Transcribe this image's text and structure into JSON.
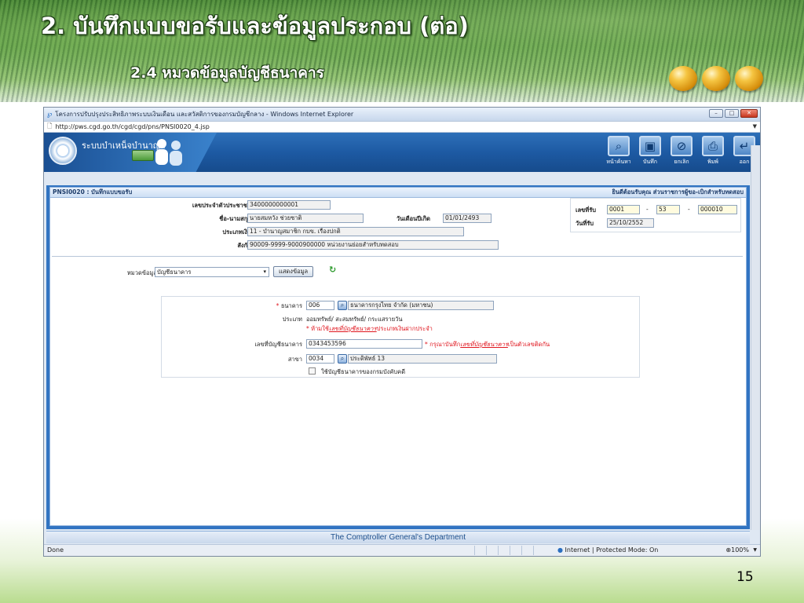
{
  "slide": {
    "title": "2. บันทึกแบบขอรับและข้อมูลประกอบ (ต่อ)",
    "subtitle": "2.4 หมวดข้อมูลบัญชีธนาคาร",
    "page_number": "15"
  },
  "browser": {
    "window_title": "โครงการปรับปรุงประสิทธิภาพระบบเงินเดือน และสวัสดิการของกรมบัญชีกลาง - Windows Internet Explorer",
    "address": "http://pws.cgd.go.th/cgd/cgd/pns/PNSI0020_4.jsp",
    "status_left": "Done",
    "status_zone": "Internet | Protected Mode: On",
    "status_zoom": "100%"
  },
  "app": {
    "name": "ระบบบำเหน็จบำนาญฯ",
    "toolbar": [
      {
        "label": "หน้าค้นหา",
        "icon": "search-icon"
      },
      {
        "label": "บันทึก",
        "icon": "save-icon"
      },
      {
        "label": "ยกเลิก",
        "icon": "cancel-icon"
      },
      {
        "label": "พิมพ์",
        "icon": "print-icon"
      },
      {
        "label": "ออก",
        "icon": "exit-icon"
      }
    ],
    "footer": "The Comptroller General's Department"
  },
  "form": {
    "code_title": "PNSI0020 : บันทึกแบบขอรับ",
    "welcome": "ยินดีต้อนรับคุณ ส่วนราชการผู้ขอ-เบิกสำหรับทดสอบ",
    "citizen_id_label": "เลขประจำตัวประชาชน",
    "citizen_id": "3400000000001",
    "name_label": "ชื่อ-นามสกุล",
    "name": "นายสมหวัง ช่วยชาติ",
    "birthdate_label": "วันเดือนปีเกิด",
    "birthdate": "01/01/2493",
    "money_type_label": "ประเภทเงิน",
    "money_type": "11 - บำนาญสมาชิก กบข.  เรื่องปกติ",
    "affiliation_label": "สังกัด",
    "affiliation": "90009-9999-9000900000  หน่วยงานย่อยสำหรับทดสอบ",
    "receipt_no_label": "เลขที่รับ",
    "receipt_no_1": "0001",
    "receipt_no_sep1": "-",
    "receipt_no_2": "53",
    "receipt_no_sep2": "-",
    "receipt_no_3": "000010",
    "receipt_date_label": "วันที่รับ",
    "receipt_date": "25/10/2552",
    "category_label": "หมวดข้อมูล",
    "category_value": "บัญชีธนาคาร",
    "show_data_button": "แสดงข้อมูล",
    "bank_label": "ธนาคาร",
    "required_mark": "*",
    "bank_code": "006",
    "bank_name": "ธนาคารกรุงไทย จำกัด (มหาชน)",
    "account_type_label": "ประเภท",
    "account_type_value": "ออมทรัพย์/ สะสมทรัพย์/ กระแสรายวัน",
    "account_type_warning_pre": "* ห้ามใช้",
    "account_type_warning_link": "เลขที่บัญชีธนาคาร",
    "account_type_warning_post": "ประเภทเงินฝากประจำ",
    "account_no_label": "เลขที่บัญชีธนาคาร",
    "account_no": "0343453596",
    "account_no_note_pre": "* กรุณาบันทึก",
    "account_no_note_link": "เลขที่บัญชีธนาคาร",
    "account_no_note_post": "เป็นตัวเลขติดกัน",
    "branch_label": "สาขา",
    "branch_code": "0034",
    "branch_name": "ประดิพัทธ์ 13",
    "use_govt_account_label": "ใช้บัญชีธนาคารของกรมบังคับคดี"
  },
  "colors": {
    "app_blue": "#3174c2",
    "required": "#e0161e",
    "refresh_green": "#2f9b2f"
  }
}
